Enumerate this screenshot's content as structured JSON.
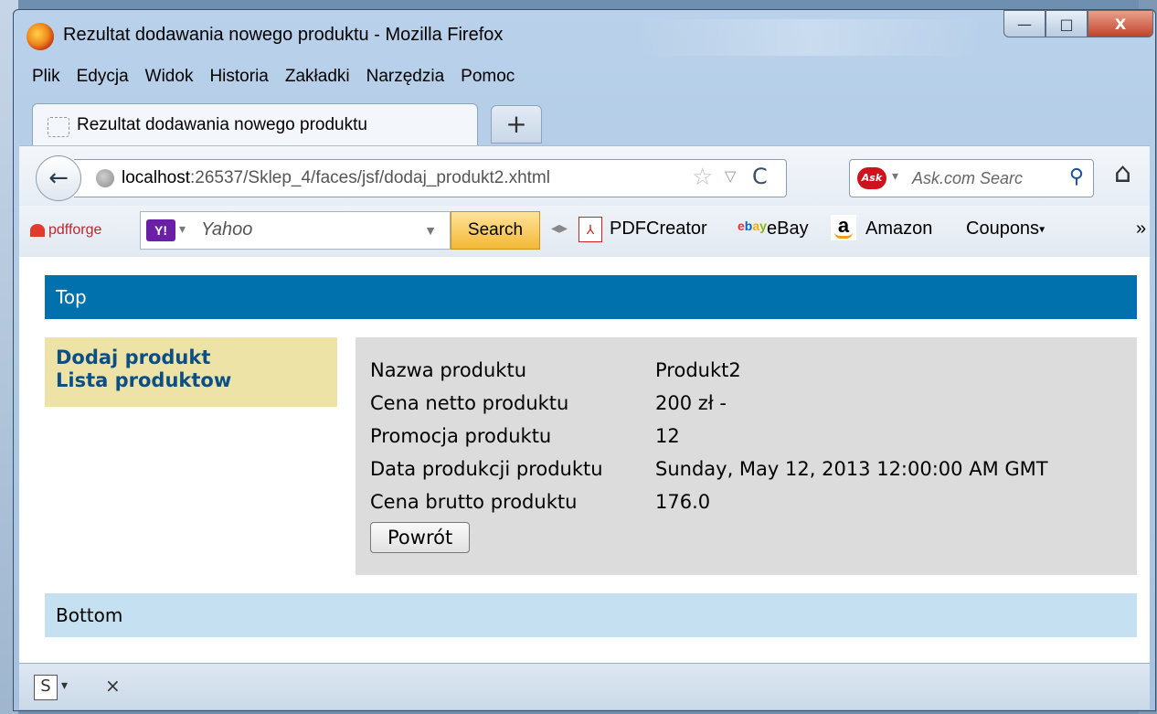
{
  "window": {
    "title": "Rezultat dodawania nowego produktu - Mozilla Firefox",
    "controls": {
      "minimize": "—",
      "maximize": "□",
      "close": "X"
    }
  },
  "menu": [
    "Plik",
    "Edycja",
    "Widok",
    "Historia",
    "Zakładki",
    "Narzędzia",
    "Pomoc"
  ],
  "tab": {
    "title": "Rezultat dodawania nowego produktu",
    "new_tab": "+"
  },
  "nav": {
    "back": "←",
    "url_host": "localhost",
    "url_rest": ":26537/Sklep_4/faces/jsf/dodaj_produkt2.xhtml",
    "bookmark_star": "☆",
    "dropdown": "▽",
    "reload": "C",
    "ask_logo": "Ask",
    "ask_placeholder": "Ask.com Searc",
    "home": "⌂"
  },
  "toolbar": {
    "pdfforge": "pdfforge",
    "yahoo_logo": "Y!",
    "yahoo_placeholder": "Yahoo",
    "search_button": "Search",
    "items": {
      "pdfcreator": "PDFCreator",
      "ebay": "eBay",
      "amazon": "Amazon",
      "coupons": "Coupons"
    },
    "ebay_icon": "ebay",
    "amazon_icon": "a",
    "more": "»"
  },
  "page": {
    "top": "Top",
    "nav_links": [
      "Dodaj produkt",
      "Lista produktow"
    ],
    "details": [
      {
        "label": "Nazwa produktu",
        "value": "Produkt2"
      },
      {
        "label": "Cena netto produktu",
        "value": "200 zł -"
      },
      {
        "label": "Promocja produktu",
        "value": "12"
      },
      {
        "label": "Data produkcji produktu",
        "value": "Sunday, May 12, 2013 12:00:00 AM GMT"
      },
      {
        "label": "Cena brutto produktu",
        "value": "176.0"
      }
    ],
    "back_button": "Powrót",
    "bottom": "Bottom"
  },
  "statusbar": {
    "icon": "S",
    "dropdown": "▾",
    "close": "×"
  },
  "colors": {
    "top_bar": "#0071ad",
    "left_nav": "#eee3a6",
    "main_panel": "#dcdcdc",
    "bottom_bar": "#c5e0f0",
    "link": "#0b4f86"
  }
}
